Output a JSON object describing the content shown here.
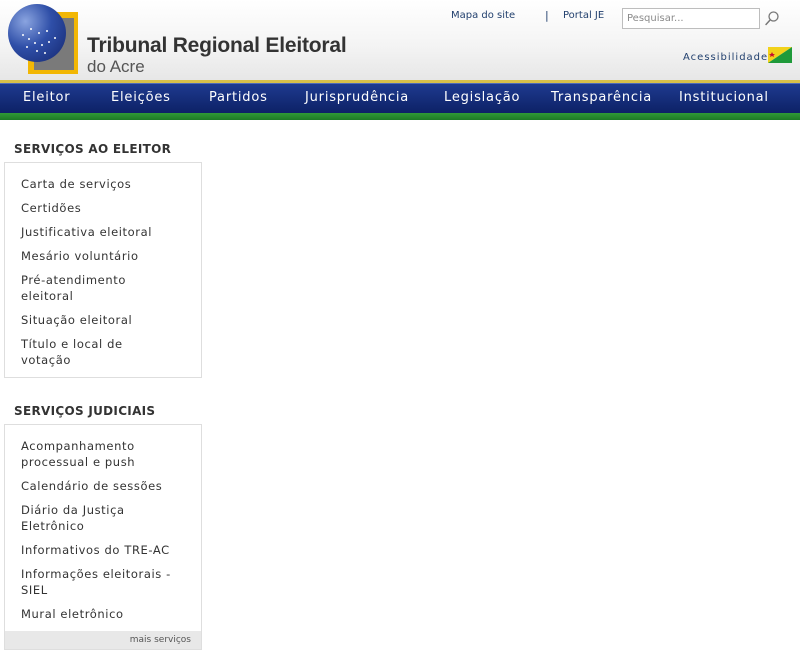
{
  "header": {
    "title": "Tribunal Regional Eleitoral",
    "subtitle": "do Acre",
    "links": {
      "site_map": "Mapa do site",
      "separator": "|",
      "portal": "Portal JE"
    },
    "search_placeholder": "Pesquisar...",
    "accessibility": "Acessibilidade",
    "icons": {
      "logo": "tre-logo-icon",
      "search": "search-icon",
      "flag": "acre-flag-icon"
    }
  },
  "nav": {
    "items": [
      "Eleitor",
      "Eleições",
      "Partidos",
      "Jurisprudência",
      "Legislação",
      "Transparência",
      "Institucional"
    ]
  },
  "sidebar": {
    "voter_services": {
      "title": "SERVIÇOS AO ELEITOR",
      "items": [
        "Carta de serviços",
        "Certidões",
        "Justificativa eleitoral",
        "Mesário voluntário",
        "Pré-atendimento eleitoral",
        "Situação eleitoral",
        "Título e local de votação"
      ]
    },
    "judicial_services": {
      "title": "SERVIÇOS JUDICIAIS",
      "items": [
        "Acompanhamento processual e push",
        "Calendário de sessões",
        "Diário da Justiça Eletrônico",
        "Informativos do TRE-AC",
        "Informações eleitorais - SIEL",
        "Mural eletrônico"
      ],
      "more_label": "mais serviços"
    }
  },
  "colors": {
    "nav_blue": "#0d2166",
    "nav_green": "#2f9a36",
    "logo_yellow": "#f2b705",
    "link_blue": "#22406e"
  }
}
